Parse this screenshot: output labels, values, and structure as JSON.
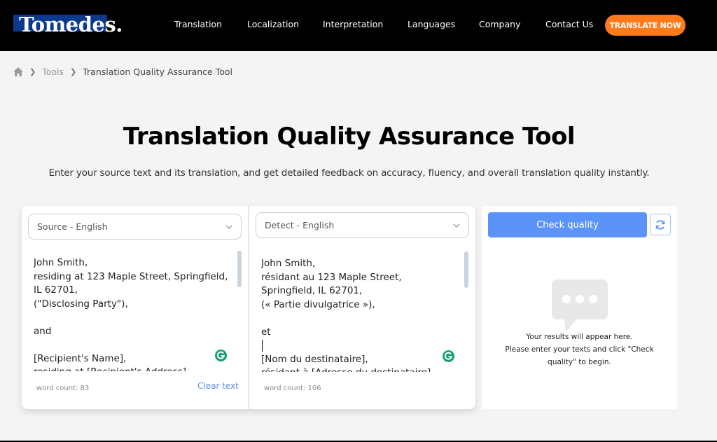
{
  "header": {
    "logo": "Tomedes.",
    "nav": [
      "Translation",
      "Localization",
      "Interpretation",
      "Languages",
      "Company",
      "Contact Us"
    ],
    "cta_label": "TRANSLATE NOW",
    "cta_color": "#ff7a1a"
  },
  "breadcrumb": {
    "home_icon": "home-icon",
    "items": [
      "Tools",
      "Translation Quality Assurance Tool"
    ]
  },
  "page": {
    "title": "Translation Quality Assurance Tool",
    "subtitle": "Enter your source text and its translation, and get detailed feedback on accuracy, fluency, and overall translation quality instantly."
  },
  "source": {
    "language_select": "Source - English",
    "text": "John Smith,\nresiding at 123 Maple Street, Springfield, IL 62701,\n(\"Disclosing Party\"),\n\nand\n\n[Recipient's Name],\nresiding at [Recipient's Address],",
    "word_count_label": "word count: 83",
    "clear_label": "Clear text"
  },
  "target": {
    "language_select": "Detect - English",
    "text": "John Smith,\nrésidant au 123 Maple Street, Springfield, IL 62701,\n(« Partie divulgatrice »),\n\net\n\n[Nom du destinataire],\nrésidant à [Adresse du destinataire],",
    "word_count_label": "word count: 106"
  },
  "results": {
    "check_label": "Check quality",
    "check_color": "#5b93f8",
    "refresh_icon": "refresh-icon",
    "placeholder_line1": "Your results will appear here.",
    "placeholder_line2": "Please enter your texts and click \"Check quality\" to begin."
  }
}
